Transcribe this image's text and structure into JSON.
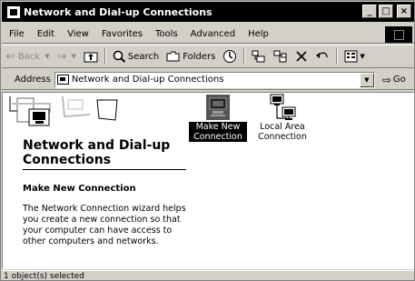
{
  "window": {
    "title": "Network and Dial-up Connections",
    "controls": {
      "minimize": "_",
      "maximize": "□",
      "close": "×"
    }
  },
  "menubar": {
    "items": [
      "File",
      "Edit",
      "View",
      "Favorites",
      "Tools",
      "Advanced",
      "Help"
    ]
  },
  "toolbar": {
    "back_label": "Back",
    "search_label": "Search",
    "folders_label": "Folders"
  },
  "address": {
    "label": "Address",
    "value": "Network and Dial-up Connections",
    "go_label": "Go"
  },
  "left_pane": {
    "heading": "Network and Dial-up Connections",
    "selected_title": "Make New Connection",
    "description": "The Network Connection wizard helps you create a new connection so that your computer can have access to other computers and networks."
  },
  "items": [
    {
      "label": "Make New Connection",
      "selected": true,
      "icon": "make-new-connection-icon"
    },
    {
      "label": "Local Area Connection",
      "selected": false,
      "icon": "local-area-connection-icon"
    }
  ],
  "statusbar": {
    "text": "1 object(s) selected"
  }
}
